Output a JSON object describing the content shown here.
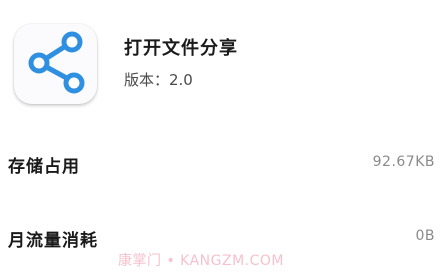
{
  "app": {
    "name": "打开文件分享",
    "version": "版本：2.0",
    "icon": "share-icon",
    "icon_color": "#2f8fe0"
  },
  "storage": {
    "label": "存储占用",
    "value": "92.67KB"
  },
  "traffic": {
    "label": "月流量消耗",
    "value": "0B"
  },
  "watermark": {
    "text": "康掌门 • KANGZM.COM",
    "color": "#ef8fa3"
  }
}
